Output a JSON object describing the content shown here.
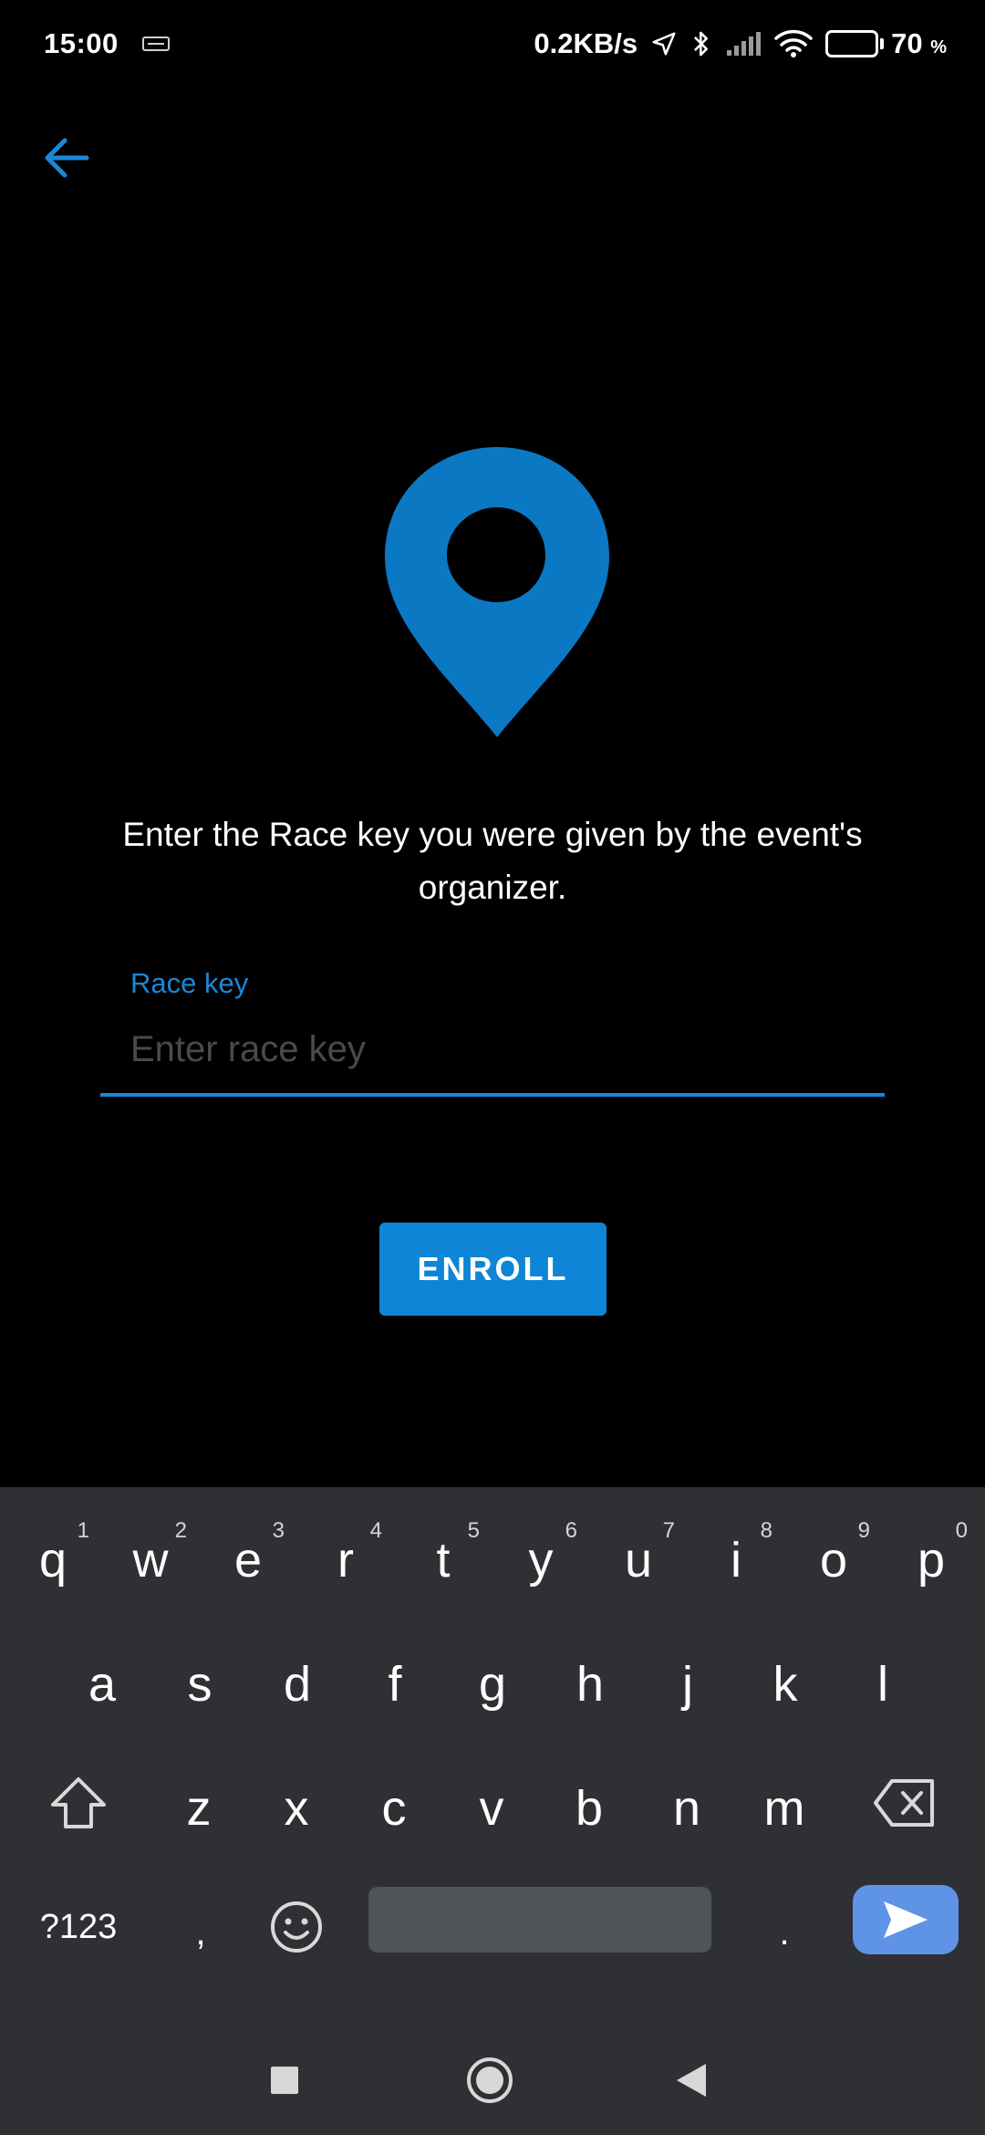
{
  "status_bar": {
    "time": "15:00",
    "net_speed": "0.2KB/s",
    "battery_percent": "70",
    "battery_unit": "%",
    "battery_level": 0.7
  },
  "screen": {
    "instructions": "Enter the Race key you were given by the event's organizer.",
    "field": {
      "label": "Race key",
      "placeholder": "Enter race key",
      "value": ""
    },
    "enroll_label": "ENROLL"
  },
  "icons": {
    "back": "arrow-left-icon",
    "pin": "map-pin-icon"
  },
  "colors": {
    "accent": "#1a88d8",
    "button": "#0e85d6",
    "background": "#000000",
    "keyboard_bg": "#2e3033",
    "send_key": "#5f93e6"
  },
  "keyboard": {
    "row1": [
      {
        "key": "q",
        "hint": "1"
      },
      {
        "key": "w",
        "hint": "2"
      },
      {
        "key": "e",
        "hint": "3"
      },
      {
        "key": "r",
        "hint": "4"
      },
      {
        "key": "t",
        "hint": "5"
      },
      {
        "key": "y",
        "hint": "6"
      },
      {
        "key": "u",
        "hint": "7"
      },
      {
        "key": "i",
        "hint": "8"
      },
      {
        "key": "o",
        "hint": "9"
      },
      {
        "key": "p",
        "hint": "0"
      }
    ],
    "row2": [
      "a",
      "s",
      "d",
      "f",
      "g",
      "h",
      "j",
      "k",
      "l"
    ],
    "row3": [
      "z",
      "x",
      "c",
      "v",
      "b",
      "n",
      "m"
    ],
    "symbols_label": "?123",
    "comma": ",",
    "period": "."
  }
}
